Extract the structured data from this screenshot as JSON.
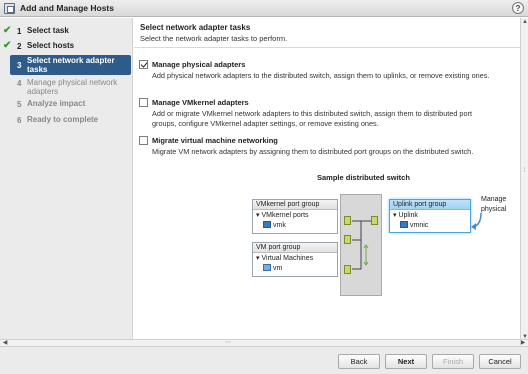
{
  "window": {
    "title": "Add and Manage Hosts",
    "help_label": "?"
  },
  "steps": [
    {
      "num": "1",
      "label": "Select task",
      "state": "done",
      "check": "✔"
    },
    {
      "num": "2",
      "label": "Select hosts",
      "state": "done",
      "check": "✔"
    },
    {
      "num": "3",
      "label": "Select network adapter tasks",
      "state": "active"
    },
    {
      "num": "4",
      "label": "Manage physical network adapters",
      "state": "future"
    },
    {
      "num": "5",
      "label": "Analyze impact",
      "state": "future"
    },
    {
      "num": "6",
      "label": "Ready to complete",
      "state": "future"
    }
  ],
  "main": {
    "heading": "Select network adapter tasks",
    "subheading": "Select the network adapter tasks to perform.",
    "options": [
      {
        "title": "Manage physical adapters",
        "checked": true,
        "desc": "Add physical network adapters to the distributed switch, assign them to uplinks, or remove existing ones."
      },
      {
        "title": "Manage VMkernel adapters",
        "checked": false,
        "desc": "Add or migrate VMkernel network adapters to this distributed switch, assign them to distributed port groups, configure VMkernel adapter settings, or remove existing ones."
      },
      {
        "title": "Migrate virtual machine networking",
        "checked": false,
        "desc": "Migrate VM network adapters by assigning them to distributed port groups on the distributed switch."
      }
    ]
  },
  "diagram": {
    "title": "Sample distributed switch",
    "vmkernel_pg": {
      "header": "VMkernel port group",
      "child": "VMkernel ports",
      "item": "vmk"
    },
    "vm_pg": {
      "header": "VM port group",
      "child": "Virtual Machines",
      "item": "vm"
    },
    "uplink_pg": {
      "header": "Uplink port group",
      "child": "Uplink",
      "item": "vmnic"
    },
    "callout": "Manage physical adapters"
  },
  "footer": {
    "back": "Back",
    "next": "Next",
    "finish": "Finish",
    "cancel": "Cancel"
  }
}
